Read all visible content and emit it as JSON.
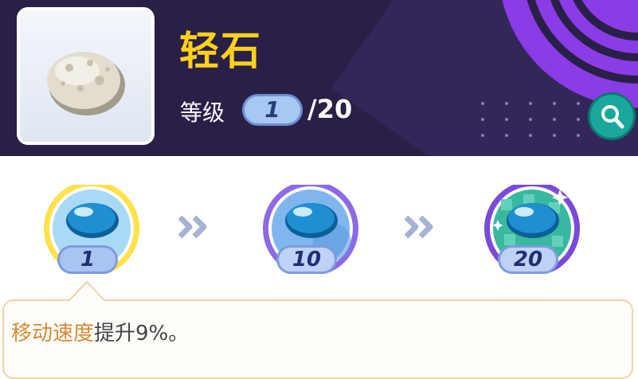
{
  "item": {
    "name": "轻石",
    "icon": "pumice-stone-icon"
  },
  "level": {
    "label": "等级",
    "current": "1",
    "max_text": "/20"
  },
  "search": {
    "icon": "search-icon"
  },
  "tiers": [
    {
      "level": "1",
      "icon": "blue-gem-icon",
      "selected": true
    },
    {
      "level": "10",
      "icon": "blue-gem-icon",
      "selected": false
    },
    {
      "level": "20",
      "icon": "blue-gem-icon",
      "selected": false
    }
  ],
  "description": {
    "highlight": "移动速度",
    "rest": "提升9%。"
  },
  "colors": {
    "header_bg": "#2a1f47",
    "accent_purple": "#8a3ce6",
    "name_yellow": "#ffd11a",
    "selected_ring": "#ffd11a",
    "search_teal": "#1aa79b",
    "highlight_text": "#d58a36"
  }
}
